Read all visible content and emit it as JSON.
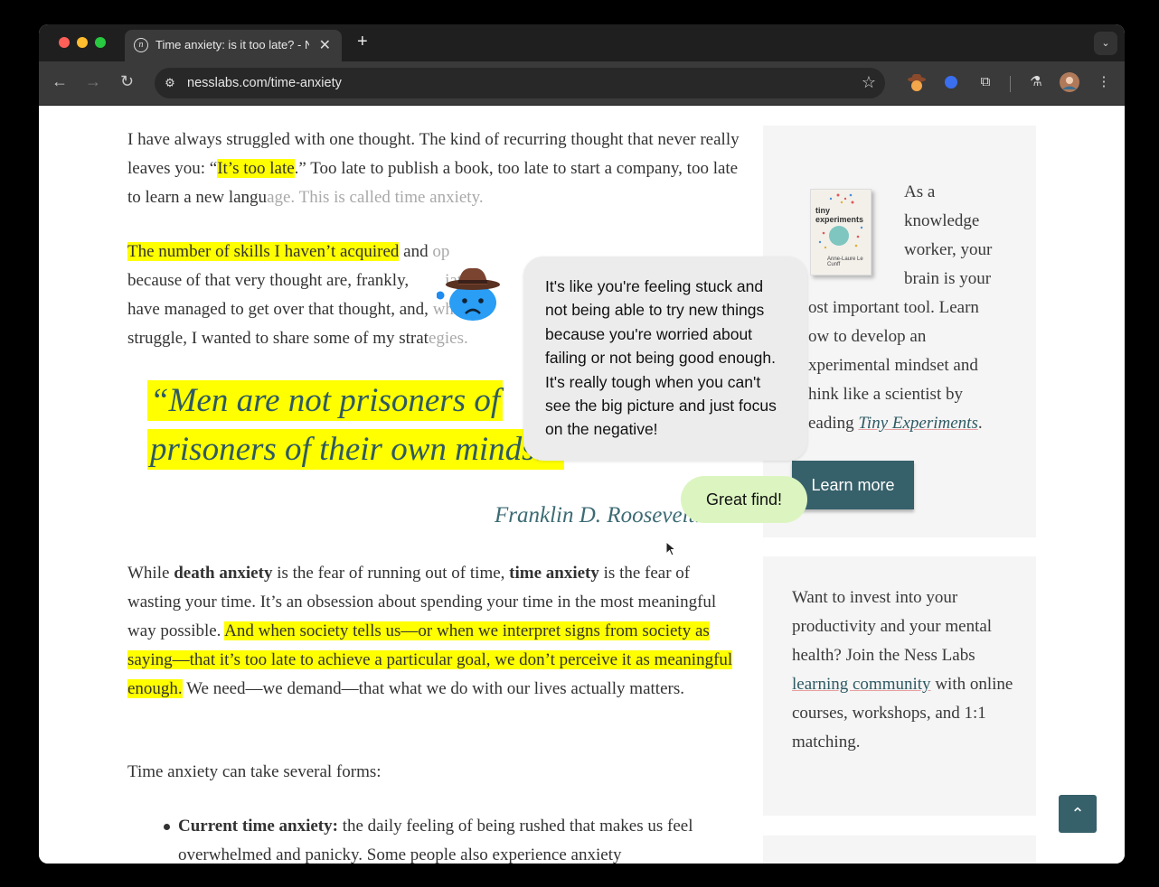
{
  "browser": {
    "tab_title": "Time anxiety: is it too late? - N",
    "tab_favicon": "n-favicon",
    "url": "nesslabs.com/time-anxiety",
    "close_tab": "✕",
    "new_tab": "+",
    "tab_dropdown": "⌄",
    "back": "←",
    "forward": "→",
    "reload": "↻",
    "site_settings": "⚙",
    "bookmark": "☆",
    "extensions": "⧉",
    "labs": "⚗",
    "menu": "⋮"
  },
  "article": {
    "p1": {
      "a": "I have always struggled with one thought. The kind of recurring thought that never really leaves you: “",
      "b": "It’s too late",
      "c": ".” Too late to publish a book, too late to start a company, too late to learn a new langu",
      "d": "age. This is called time anxiety."
    },
    "p2": {
      "a": "The number of skills I haven’t acquired",
      "b": " and",
      "c": " op",
      "d": "because of that very thought are, frankly,",
      "e": "iatin",
      "f": "have managed to get over that thought, and,",
      "g": " while",
      "h": "struggle, I wanted to share some of my strat",
      "i": "egies."
    },
    "quote": {
      "line1": "“Men are not prisoners of",
      "line2": "prisoners of their own minds.”"
    },
    "attribution": "Franklin D. Roosevelt.",
    "p3": {
      "a": "While ",
      "b": "death anxiety",
      "c": " is the fear of running out of time, ",
      "d": "time anxiety",
      "e": " is the fear of wasting your time. It’s an obsession about spending your time in the most meaningful way possible. ",
      "f": "And when society tells us—or when we interpret signs from society as saying—that it’s too late to achieve a particular goal, we don’t perceive it as meaningful enough.",
      "g": " We need—we demand—that what we do with our lives actually matters."
    },
    "p4": "Time anxiety can take several forms:",
    "bullet1": {
      "label": "Current time anxiety:",
      "text": " the daily feeling of being rushed that makes us feel overwhelmed and panicky. Some people also experience anxiety"
    }
  },
  "sidebar": {
    "book": {
      "title": "tiny experiments",
      "author": "Anne-Laure Le Cunff"
    },
    "promo": {
      "l1": "As a",
      "l2": "knowledge",
      "l3": "worker, your",
      "l4": "brain is your",
      "l5": "ost important tool. Learn",
      "l6": "ow to develop an",
      "l7": "xperimental mindset and",
      "l8": "hink like a scientist by",
      "l9a": "eading ",
      "l9link": "Tiny Experiments",
      "l9b": "."
    },
    "learn_more": "Learn more",
    "community": {
      "a": "Want to invest into your productivity and your mental health? Join the Ness Labs ",
      "link": "learning community",
      "b": " with online courses, workshops, and 1:1 matching."
    }
  },
  "overlay": {
    "bubble": "It's like you're feeling stuck and not being able to try new things because you're worried about failing or not being good enough. It's really tough when you can't see the big picture and just focus on the negative!",
    "reply": "Great find!"
  },
  "back_to_top": "⌃"
}
